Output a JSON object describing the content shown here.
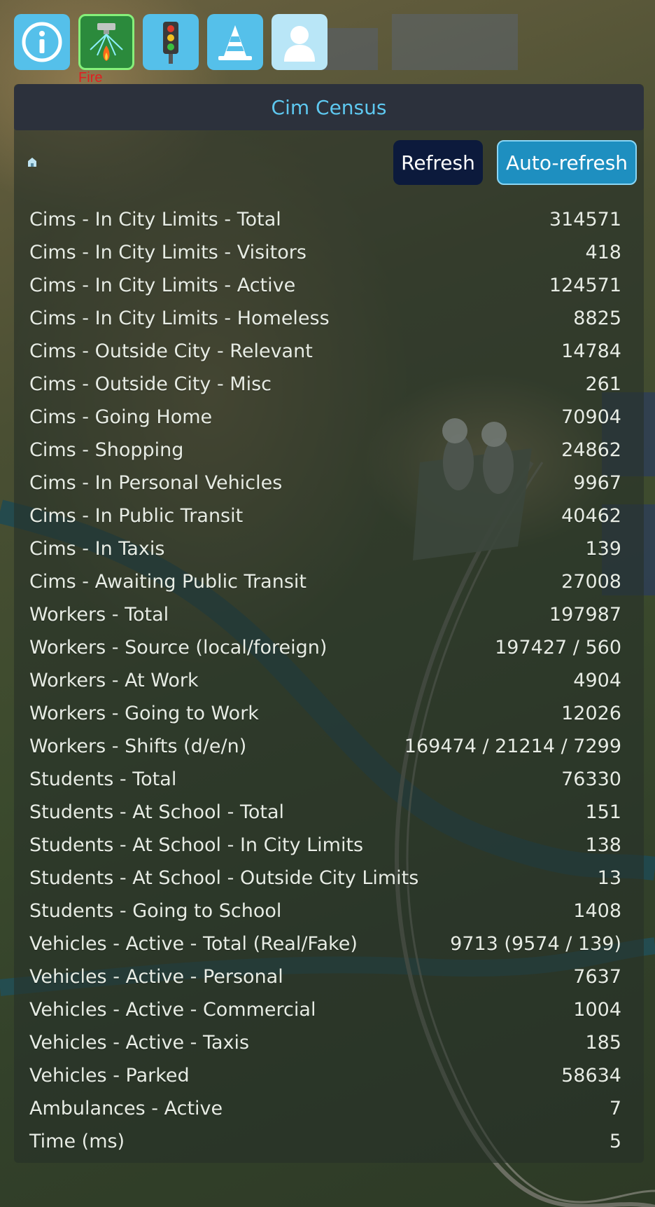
{
  "toolbar": {
    "buttons": [
      {
        "icon": "info-icon"
      },
      {
        "icon": "fire-station-icon",
        "label": "Fire"
      },
      {
        "icon": "traffic-light-icon"
      },
      {
        "icon": "traffic-cone-icon"
      },
      {
        "icon": "person-icon"
      }
    ]
  },
  "panel": {
    "title": "Cim Census",
    "refresh_label": "Refresh",
    "auto_refresh_label": "Auto-refresh",
    "rows": [
      {
        "label": "Cims - In City Limits - Total",
        "value": "314571"
      },
      {
        "label": "Cims - In City Limits - Visitors",
        "value": "418"
      },
      {
        "label": "Cims - In City Limits - Active",
        "value": "124571"
      },
      {
        "label": "Cims - In City Limits - Homeless",
        "value": "8825"
      },
      {
        "label": "Cims - Outside City - Relevant",
        "value": "14784"
      },
      {
        "label": "Cims - Outside City - Misc",
        "value": "261"
      },
      {
        "label": "Cims - Going Home",
        "value": "70904"
      },
      {
        "label": "Cims - Shopping",
        "value": "24862"
      },
      {
        "label": "Cims - In Personal Vehicles",
        "value": "9967"
      },
      {
        "label": "Cims - In Public Transit",
        "value": "40462"
      },
      {
        "label": "Cims - In Taxis",
        "value": "139"
      },
      {
        "label": "Cims - Awaiting Public Transit",
        "value": "27008"
      },
      {
        "label": "Workers - Total",
        "value": "197987"
      },
      {
        "label": "Workers - Source (local/foreign)",
        "value": "197427 / 560"
      },
      {
        "label": "Workers - At Work",
        "value": "4904"
      },
      {
        "label": "Workers - Going to Work",
        "value": "12026"
      },
      {
        "label": "Workers - Shifts (d/e/n)",
        "value": "169474 / 21214 / 7299"
      },
      {
        "label": "Students - Total",
        "value": "76330"
      },
      {
        "label": "Students - At School - Total",
        "value": "151"
      },
      {
        "label": "Students - At School - In City Limits",
        "value": "138"
      },
      {
        "label": "Students - At School - Outside City Limits",
        "value": "13"
      },
      {
        "label": "Students - Going to School",
        "value": "1408"
      },
      {
        "label": "Vehicles - Active - Total (Real/Fake)",
        "value": "9713 (9574 / 139)"
      },
      {
        "label": "Vehicles - Active - Personal",
        "value": "7637"
      },
      {
        "label": "Vehicles - Active - Commercial",
        "value": "1004"
      },
      {
        "label": "Vehicles - Active - Taxis",
        "value": "185"
      },
      {
        "label": "Vehicles - Parked",
        "value": "58634"
      },
      {
        "label": "Ambulances - Active",
        "value": "7"
      },
      {
        "label": "Time (ms)",
        "value": "5"
      }
    ]
  },
  "colors": {
    "title": "#5ec8f0",
    "toolbar_button": "#55c0ea",
    "active_button": "#2b8a3c",
    "refresh_button": "#0c1a3c",
    "auto_refresh_button": "#1e8fc0",
    "fire_label": "#e02020"
  }
}
